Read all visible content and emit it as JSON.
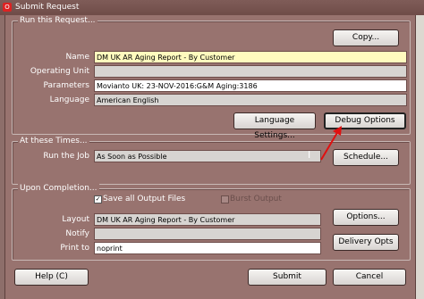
{
  "window": {
    "title": "Submit Request"
  },
  "run_request": {
    "group_title": "Run this Request...",
    "copy_button": "Copy...",
    "fields": [
      {
        "label": "Name",
        "value": "DM UK AR Aging Report - By Customer"
      },
      {
        "label": "Operating Unit",
        "value": ""
      },
      {
        "label": "Parameters",
        "value": "Movianto UK: 23-NOV-2016:G&M Aging:3186"
      },
      {
        "label": "Language",
        "value": "American English"
      }
    ],
    "language_settings_button": "Language Settings...",
    "debug_options_button": "Debug Options"
  },
  "schedule": {
    "group_title": "At these Times...",
    "run_job_label": "Run the Job",
    "run_job_value": "As Soon as Possible",
    "schedule_button": "Schedule..."
  },
  "completion": {
    "group_title": "Upon Completion...",
    "save_all_label": "Save all Output Files",
    "save_all_checked": true,
    "burst_label": "Burst Output",
    "burst_checked": false,
    "layout_label": "Layout",
    "layout_value": "DM UK AR Aging Report - By Customer",
    "notify_label": "Notify",
    "notify_value": "",
    "print_to_label": "Print to",
    "print_to_value": "noprint",
    "options_button": "Options...",
    "delivery_button": "Delivery Opts"
  },
  "footer": {
    "help_button": "Help (C)",
    "submit_button": "Submit",
    "cancel_button": "Cancel"
  },
  "colors": {
    "dialog_bg": "#98736f",
    "required_field": "#fffbbe",
    "annotation_arrow": "#e01010"
  }
}
